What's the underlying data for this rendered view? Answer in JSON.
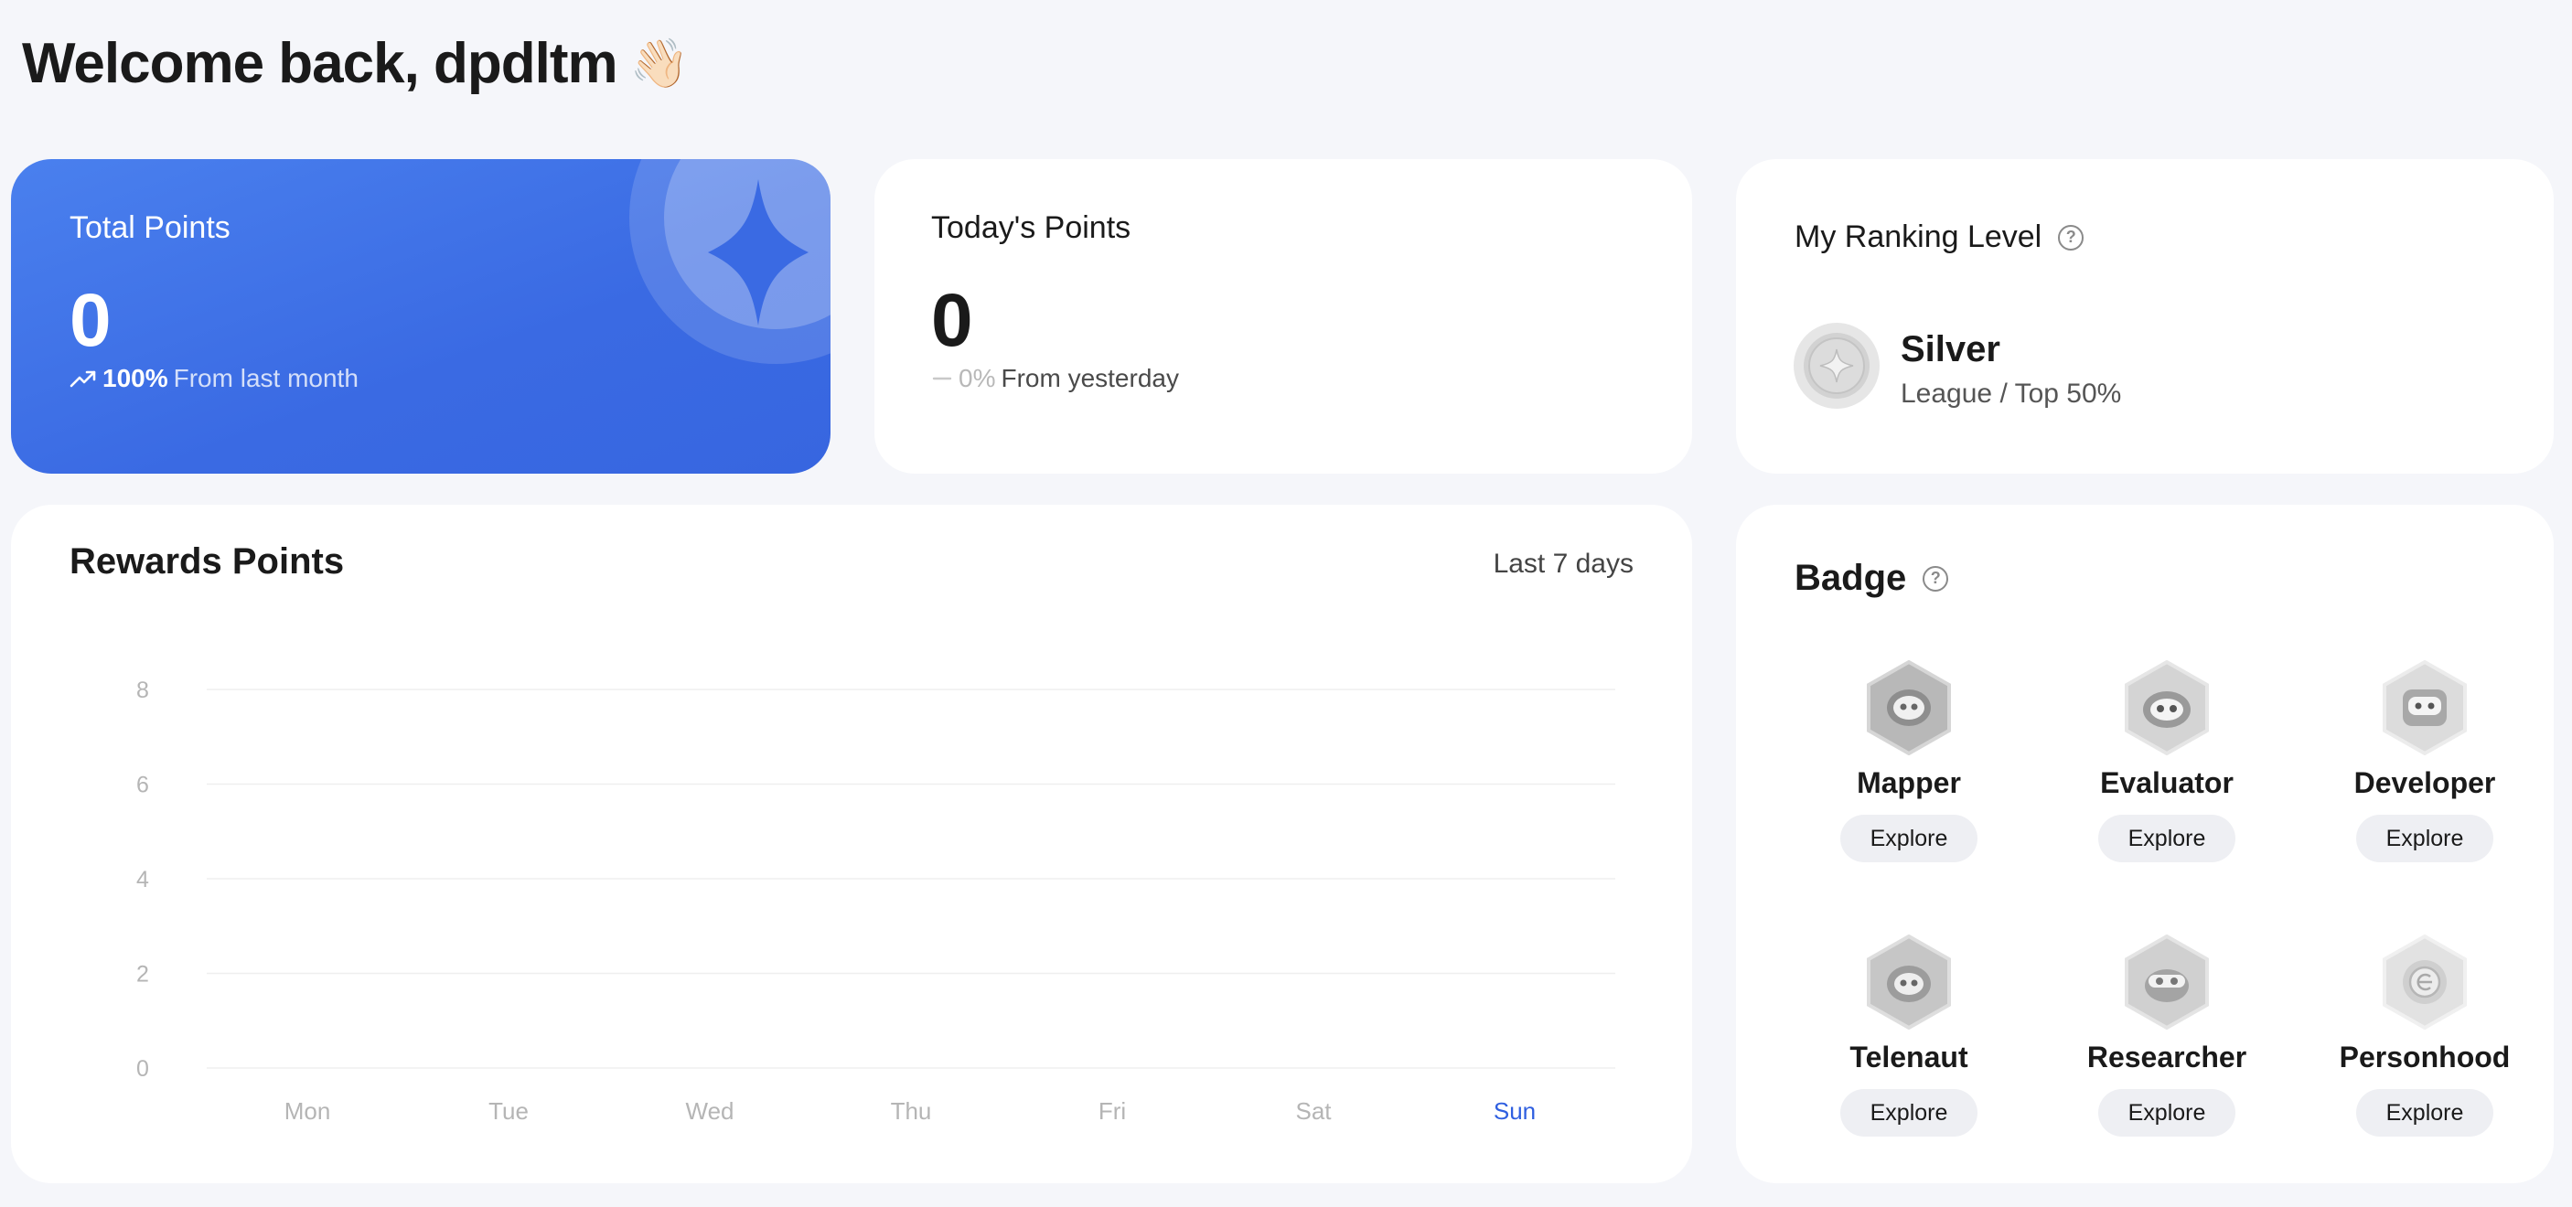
{
  "welcome": {
    "title": "Welcome back, dpdltm",
    "emoji": "👋🏻"
  },
  "total_points": {
    "title": "Total Points",
    "value": "0",
    "change_pct": "100%",
    "change_text": "From last month",
    "trend_icon": "trend-up-icon"
  },
  "today_points": {
    "title": "Today's Points",
    "value": "0",
    "change_pct": "0%",
    "change_text": "From yesterday",
    "trend_icon": "dash-icon"
  },
  "ranking": {
    "title": "My Ranking Level",
    "help_icon": "help-icon",
    "level": "Silver",
    "subtitle": "League / Top 50%"
  },
  "rewards": {
    "title": "Rewards Points",
    "range": "Last 7 days"
  },
  "chart_data": {
    "type": "bar",
    "categories": [
      "Mon",
      "Tue",
      "Wed",
      "Thu",
      "Fri",
      "Sat",
      "Sun"
    ],
    "values": [
      0,
      0,
      0,
      0,
      0,
      0,
      0
    ],
    "yticks": [
      "0",
      "2",
      "4",
      "6",
      "8"
    ],
    "ylim": [
      0,
      8
    ],
    "grid": true,
    "highlight_category": "Sun",
    "highlight_color": "#2f5fe0"
  },
  "badge": {
    "title": "Badge",
    "items": [
      {
        "name": "Mapper",
        "button": "Explore"
      },
      {
        "name": "Evaluator",
        "button": "Explore"
      },
      {
        "name": "Developer",
        "button": "Explore"
      },
      {
        "name": "Telenaut",
        "button": "Explore"
      },
      {
        "name": "Researcher",
        "button": "Explore"
      },
      {
        "name": "Personhood",
        "button": "Explore"
      }
    ]
  },
  "colors": {
    "accent": "#3a6ae3",
    "background": "#f5f6fa",
    "card": "#ffffff"
  }
}
